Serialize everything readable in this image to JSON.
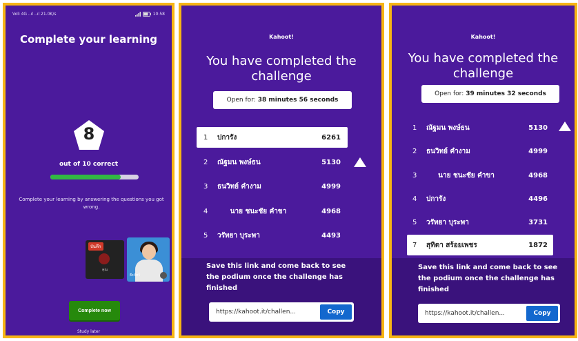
{
  "panel1": {
    "status": {
      "left": "Voli 4G  ..ıl  ..ıl  21.0K/s",
      "right": "10:58"
    },
    "title": "Complete your learning",
    "score": "8",
    "out_of": "out of 10 correct",
    "progress_fraction": 0.8,
    "description": "Complete your learning by answering the questions you got wrong.",
    "video_left_tag": "บันทึก",
    "video_left_name": "คุณ",
    "video_right_name": "ธีรภัทร์",
    "complete_button": "Complete now",
    "study_later": "Study later"
  },
  "panel2": {
    "logo": "Kahoot!",
    "title": "You have completed the challenge",
    "open_label": "Open for:",
    "open_value": "38 minutes 56 seconds",
    "leaderboard": [
      {
        "rank": "1",
        "name": "ปการัง",
        "score": "6261",
        "highlight": true
      },
      {
        "rank": "2",
        "name": "ณัฐมน พงษ์ธน",
        "score": "5130",
        "highlight": false
      },
      {
        "rank": "3",
        "name": "ธนวิทย์ คำงาม",
        "score": "4999",
        "highlight": false
      },
      {
        "rank": "4",
        "name": "นาย ชนะชัย คำขา",
        "score": "4968",
        "highlight": false
      },
      {
        "rank": "5",
        "name": "วรัทยา บุระพา",
        "score": "4493",
        "highlight": false
      }
    ],
    "footer_message": "Save this link and come back to see the podium once the challenge has finished",
    "link": "https://kahoot.it/challen...",
    "copy_label": "Copy"
  },
  "panel3": {
    "logo": "Kahoot!",
    "title": "You have completed the challenge",
    "open_label": "Open for:",
    "open_value": "39 minutes 32 seconds",
    "leaderboard": [
      {
        "rank": "1",
        "name": "ณัฐมน พงษ์ธน",
        "score": "5130",
        "highlight": false
      },
      {
        "rank": "2",
        "name": "ธนวิทย์ คำงาม",
        "score": "4999",
        "highlight": false
      },
      {
        "rank": "3",
        "name": "นาย ชนะชัย คำขา",
        "score": "4968",
        "highlight": false
      },
      {
        "rank": "4",
        "name": "ปการัง",
        "score": "4496",
        "highlight": false
      },
      {
        "rank": "5",
        "name": "วรัทยา บุระพา",
        "score": "3731",
        "highlight": false
      },
      {
        "rank": "7",
        "name": "สุทิตา สร้อยเพชร",
        "score": "1872",
        "highlight": true
      }
    ],
    "footer_message": "Save this link and come back to see the podium once the challenge has finished",
    "link": "https://kahoot.it/challen...",
    "copy_label": "Copy"
  },
  "colors": {
    "frame": "#f7b515",
    "background": "#4b1a9c",
    "footer": "#3a127c",
    "green": "#26890c",
    "copy_blue": "#1368ce"
  },
  "icons": [
    "up-arrow-icon",
    "signal-icon",
    "battery-icon"
  ]
}
